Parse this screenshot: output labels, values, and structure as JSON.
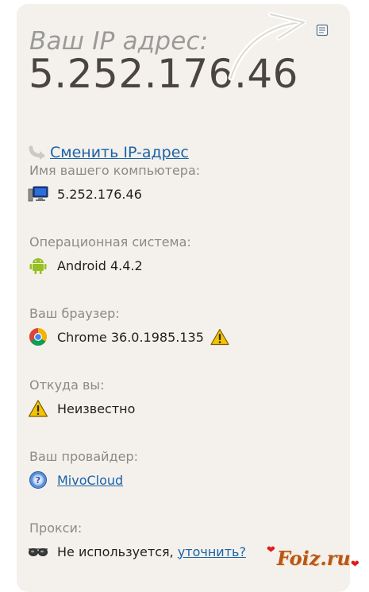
{
  "header": {
    "title": "Ваш IP адрес:",
    "ip": "5.252.176.46"
  },
  "actions": {
    "change_ip_label": "Сменить IP-адрес"
  },
  "sections": {
    "computer_name": {
      "label": "Имя вашего компьютера:",
      "value": "5.252.176.46",
      "icon": "computer-icon"
    },
    "os": {
      "label": "Операционная система:",
      "value": "Android 4.4.2",
      "icon": "android-icon"
    },
    "browser": {
      "label": "Ваш браузер:",
      "value": "Chrome 36.0.1985.135",
      "icon": "chrome-icon",
      "status_icon": "warning-icon"
    },
    "location": {
      "label": "Откуда вы:",
      "value": "Неизвестно",
      "icon": "warning-icon"
    },
    "provider": {
      "label": "Ваш провайдер:",
      "value": "MivoCloud",
      "icon": "info-globe-icon"
    },
    "proxy": {
      "label": "Прокси:",
      "value": "Не используется,",
      "link": "уточнить?",
      "icon": "glasses-icon"
    }
  },
  "watermark": {
    "text": "Foiz.ru"
  },
  "colors": {
    "card_background": "#f4f1ec",
    "link": "#1a63a8",
    "ip_text": "#4a4540",
    "label_text": "#8a8a8a",
    "warning": "#f5c400"
  }
}
